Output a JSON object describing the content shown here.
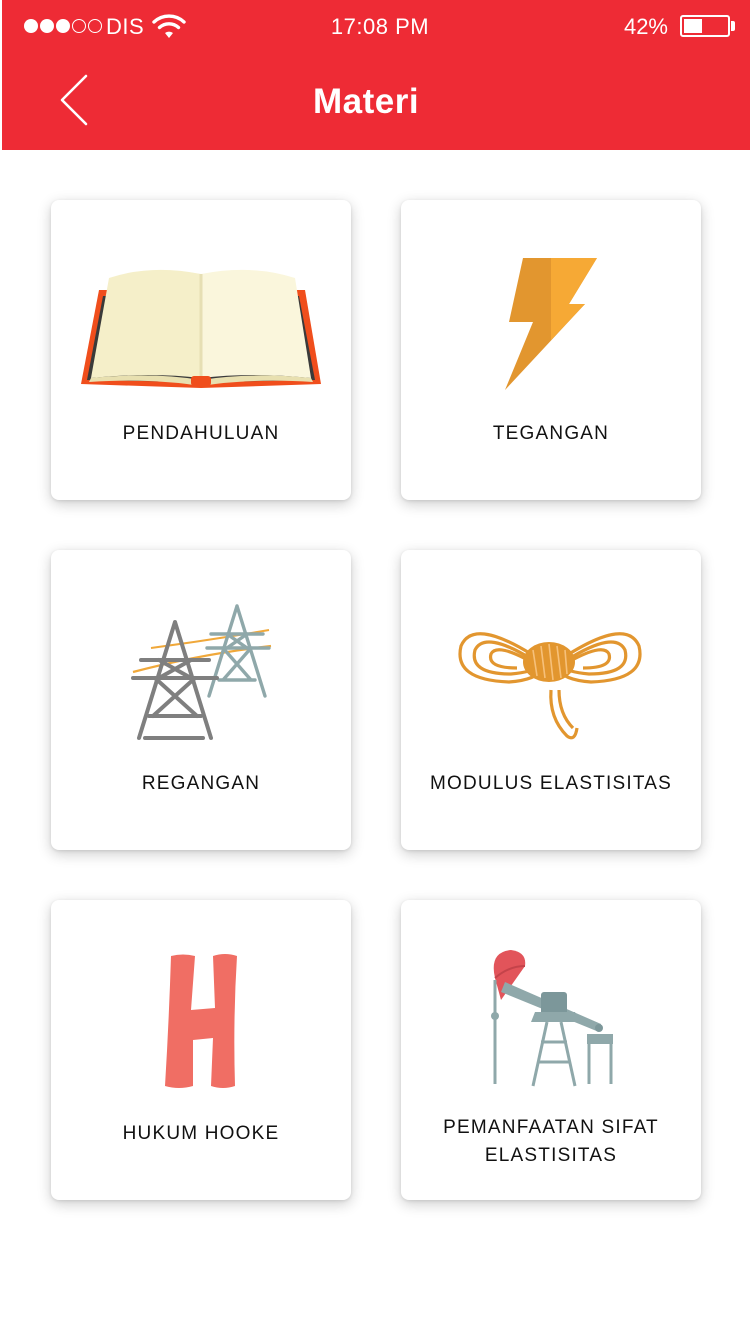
{
  "status_bar": {
    "carrier": "DIS",
    "time": "17:08 PM",
    "battery_percent": "42%",
    "battery_level": 0.42,
    "signal_strength": 3,
    "signal_max": 5
  },
  "header": {
    "title": "Materi",
    "back_icon": "chevron-left-icon",
    "color": "#ee2b35"
  },
  "cards": [
    {
      "label": "PENDAHULUAN",
      "icon": "open-book-icon"
    },
    {
      "label": "TEGANGAN",
      "icon": "lightning-bolt-icon"
    },
    {
      "label": "REGANGAN",
      "icon": "power-tower-icon"
    },
    {
      "label": "MODULUS ELASTISITAS",
      "icon": "rope-knot-icon"
    },
    {
      "label": "HUKUM HOOKE",
      "icon": "letter-h-icon"
    },
    {
      "label": "PEMANFAATAN SIFAT\nELASTISITAS",
      "icon": "pump-jack-icon"
    }
  ]
}
